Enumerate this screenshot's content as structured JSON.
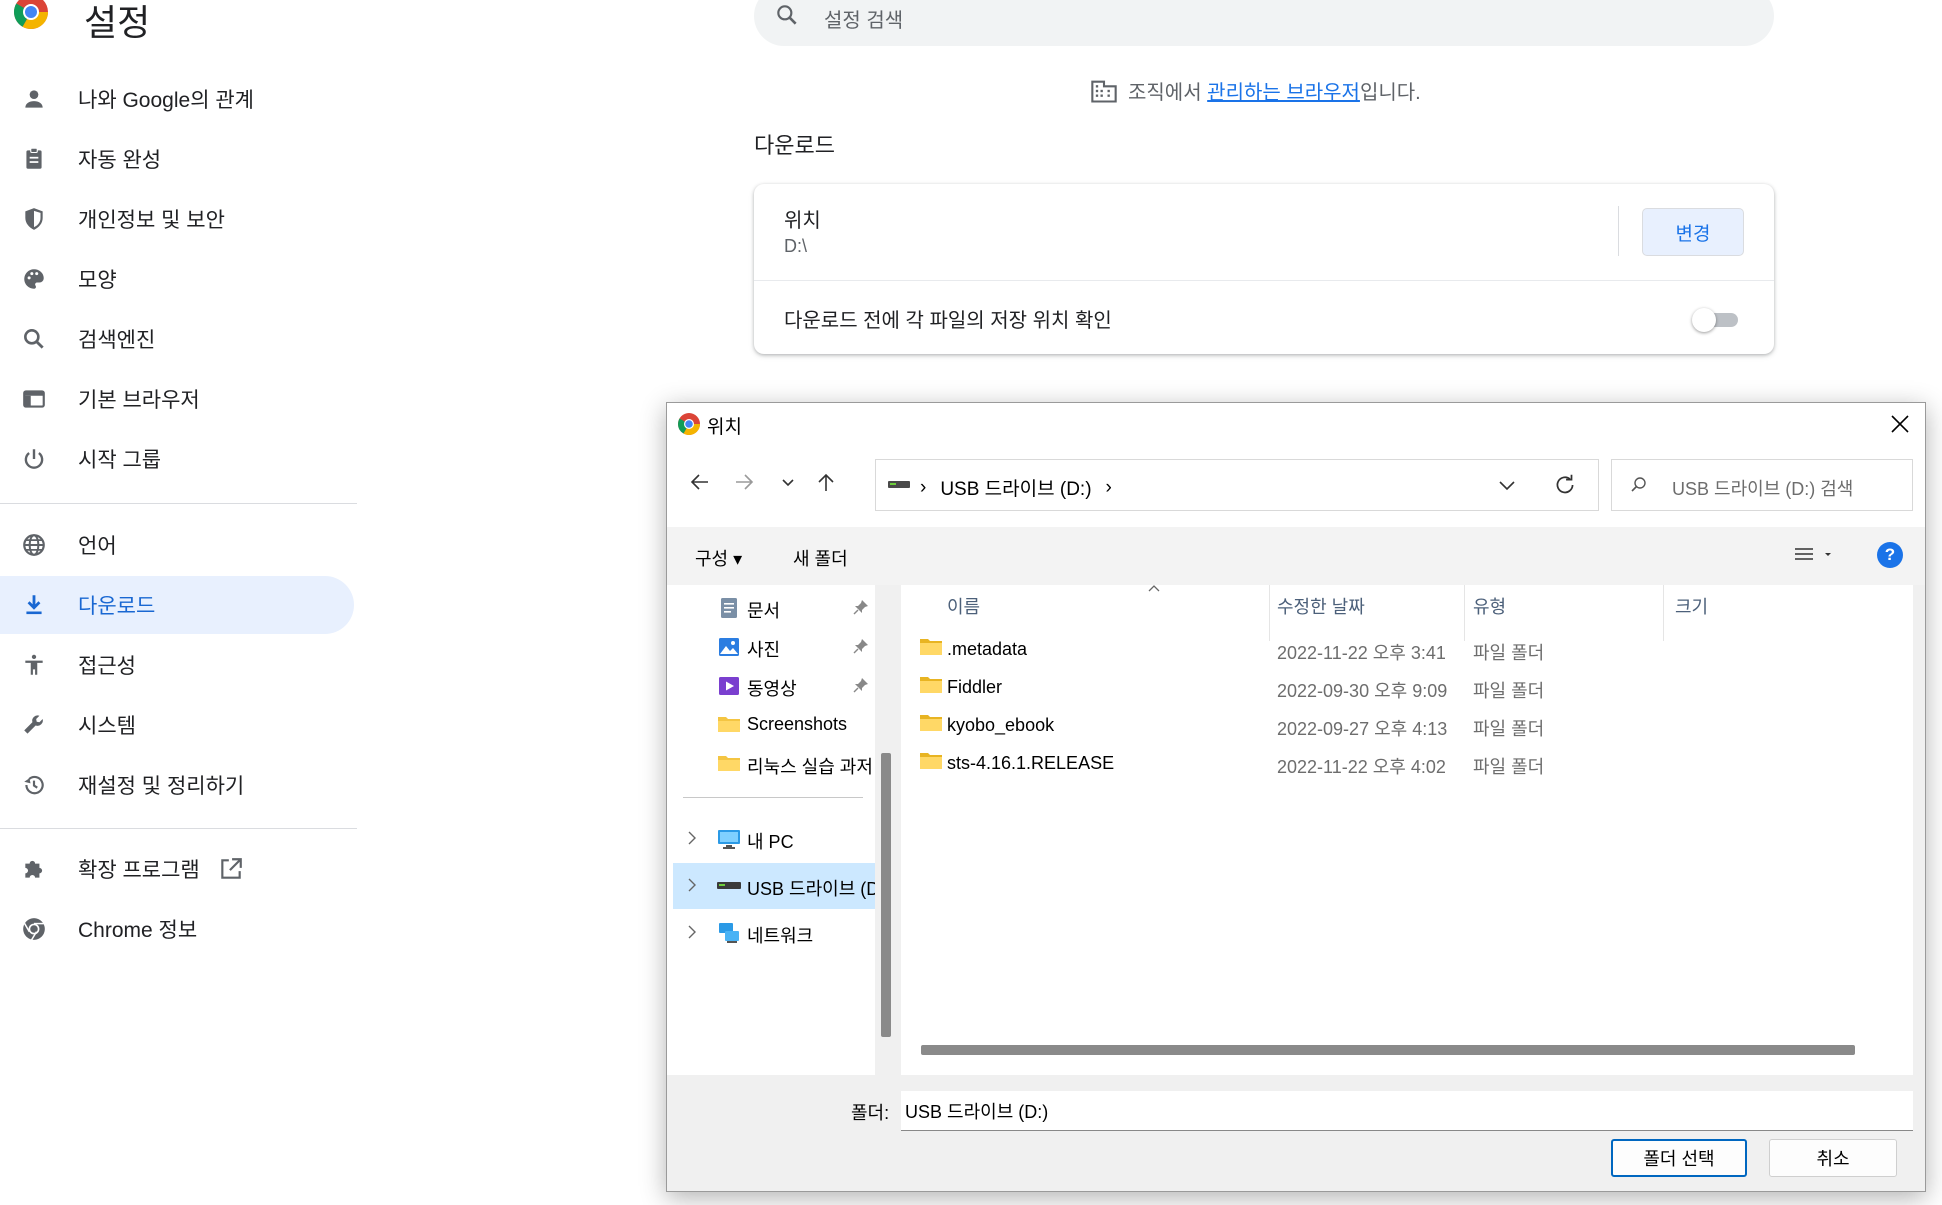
{
  "app": {
    "title": "설정"
  },
  "search": {
    "placeholder": "설정 검색"
  },
  "sidebar": {
    "items": [
      {
        "label": "나와 Google의 관계",
        "icon": "person-icon"
      },
      {
        "label": "자동 완성",
        "icon": "clipboard-icon"
      },
      {
        "label": "개인정보 및 보안",
        "icon": "shield-icon"
      },
      {
        "label": "모양",
        "icon": "palette-icon"
      },
      {
        "label": "검색엔진",
        "icon": "search-icon"
      },
      {
        "label": "기본 브라우저",
        "icon": "browser-window-icon"
      },
      {
        "label": "시작 그룹",
        "icon": "power-icon"
      },
      {
        "label": "언어",
        "icon": "globe-icon"
      },
      {
        "label": "다운로드",
        "icon": "download-icon",
        "active": true
      },
      {
        "label": "접근성",
        "icon": "accessibility-icon"
      },
      {
        "label": "시스템",
        "icon": "wrench-icon"
      },
      {
        "label": "재설정 및 정리하기",
        "icon": "history-icon"
      },
      {
        "label": "확장 프로그램",
        "icon": "puzzle-icon"
      },
      {
        "label": "Chrome 정보",
        "icon": "chrome-icon"
      }
    ]
  },
  "managed": {
    "prefix": "조직에서 ",
    "link": "관리하는 브라우저",
    "suffix": "입니다."
  },
  "downloads": {
    "section_title": "다운로드",
    "location_label": "위치",
    "location_value": "D:\\",
    "change_button": "변경",
    "ask_label": "다운로드 전에 각 파일의 저장 위치 확인",
    "ask_enabled": false
  },
  "dialog": {
    "title": "위치",
    "address": {
      "drive": "USB 드라이브 (D:)"
    },
    "search_placeholder": "USB 드라이브 (D:) 검색",
    "organize": "구성",
    "new_folder": "새 폴더",
    "tree": [
      {
        "label": "문서",
        "icon": "document-folder-icon",
        "pinned": true
      },
      {
        "label": "사진",
        "icon": "pictures-folder-icon",
        "pinned": true
      },
      {
        "label": "동영상",
        "icon": "videos-folder-icon",
        "pinned": true
      },
      {
        "label": "Screenshots",
        "icon": "folder-icon",
        "pinned": false
      },
      {
        "label": "리눅스 실습 과저",
        "icon": "folder-icon",
        "pinned": false
      },
      {
        "label": "내 PC",
        "icon": "pc-icon"
      },
      {
        "label": "USB 드라이브 (D",
        "icon": "drive-icon",
        "selected": true
      },
      {
        "label": "네트워크",
        "icon": "network-icon"
      }
    ],
    "columns": {
      "name": "이름",
      "date": "수정한 날짜",
      "type": "유형",
      "size": "크기"
    },
    "files": [
      {
        "name": ".metadata",
        "date": "2022-11-22 오후 3:41",
        "type": "파일 폴더"
      },
      {
        "name": "Fiddler",
        "date": "2022-09-30 오후 9:09",
        "type": "파일 폴더"
      },
      {
        "name": "kyobo_ebook",
        "date": "2022-09-27 오후 4:13",
        "type": "파일 폴더"
      },
      {
        "name": "sts-4.16.1.RELEASE",
        "date": "2022-11-22 오후 4:02",
        "type": "파일 폴더"
      }
    ],
    "folder_label": "폴더:",
    "folder_value": "USB 드라이브 (D:)",
    "select_button": "폴더 선택",
    "cancel_button": "취소"
  },
  "colors": {
    "accent": "#1a73e8",
    "active_bg": "#e8f0fe",
    "dialog_select": "#cce8ff",
    "folder_yellow": "#f4c542"
  }
}
